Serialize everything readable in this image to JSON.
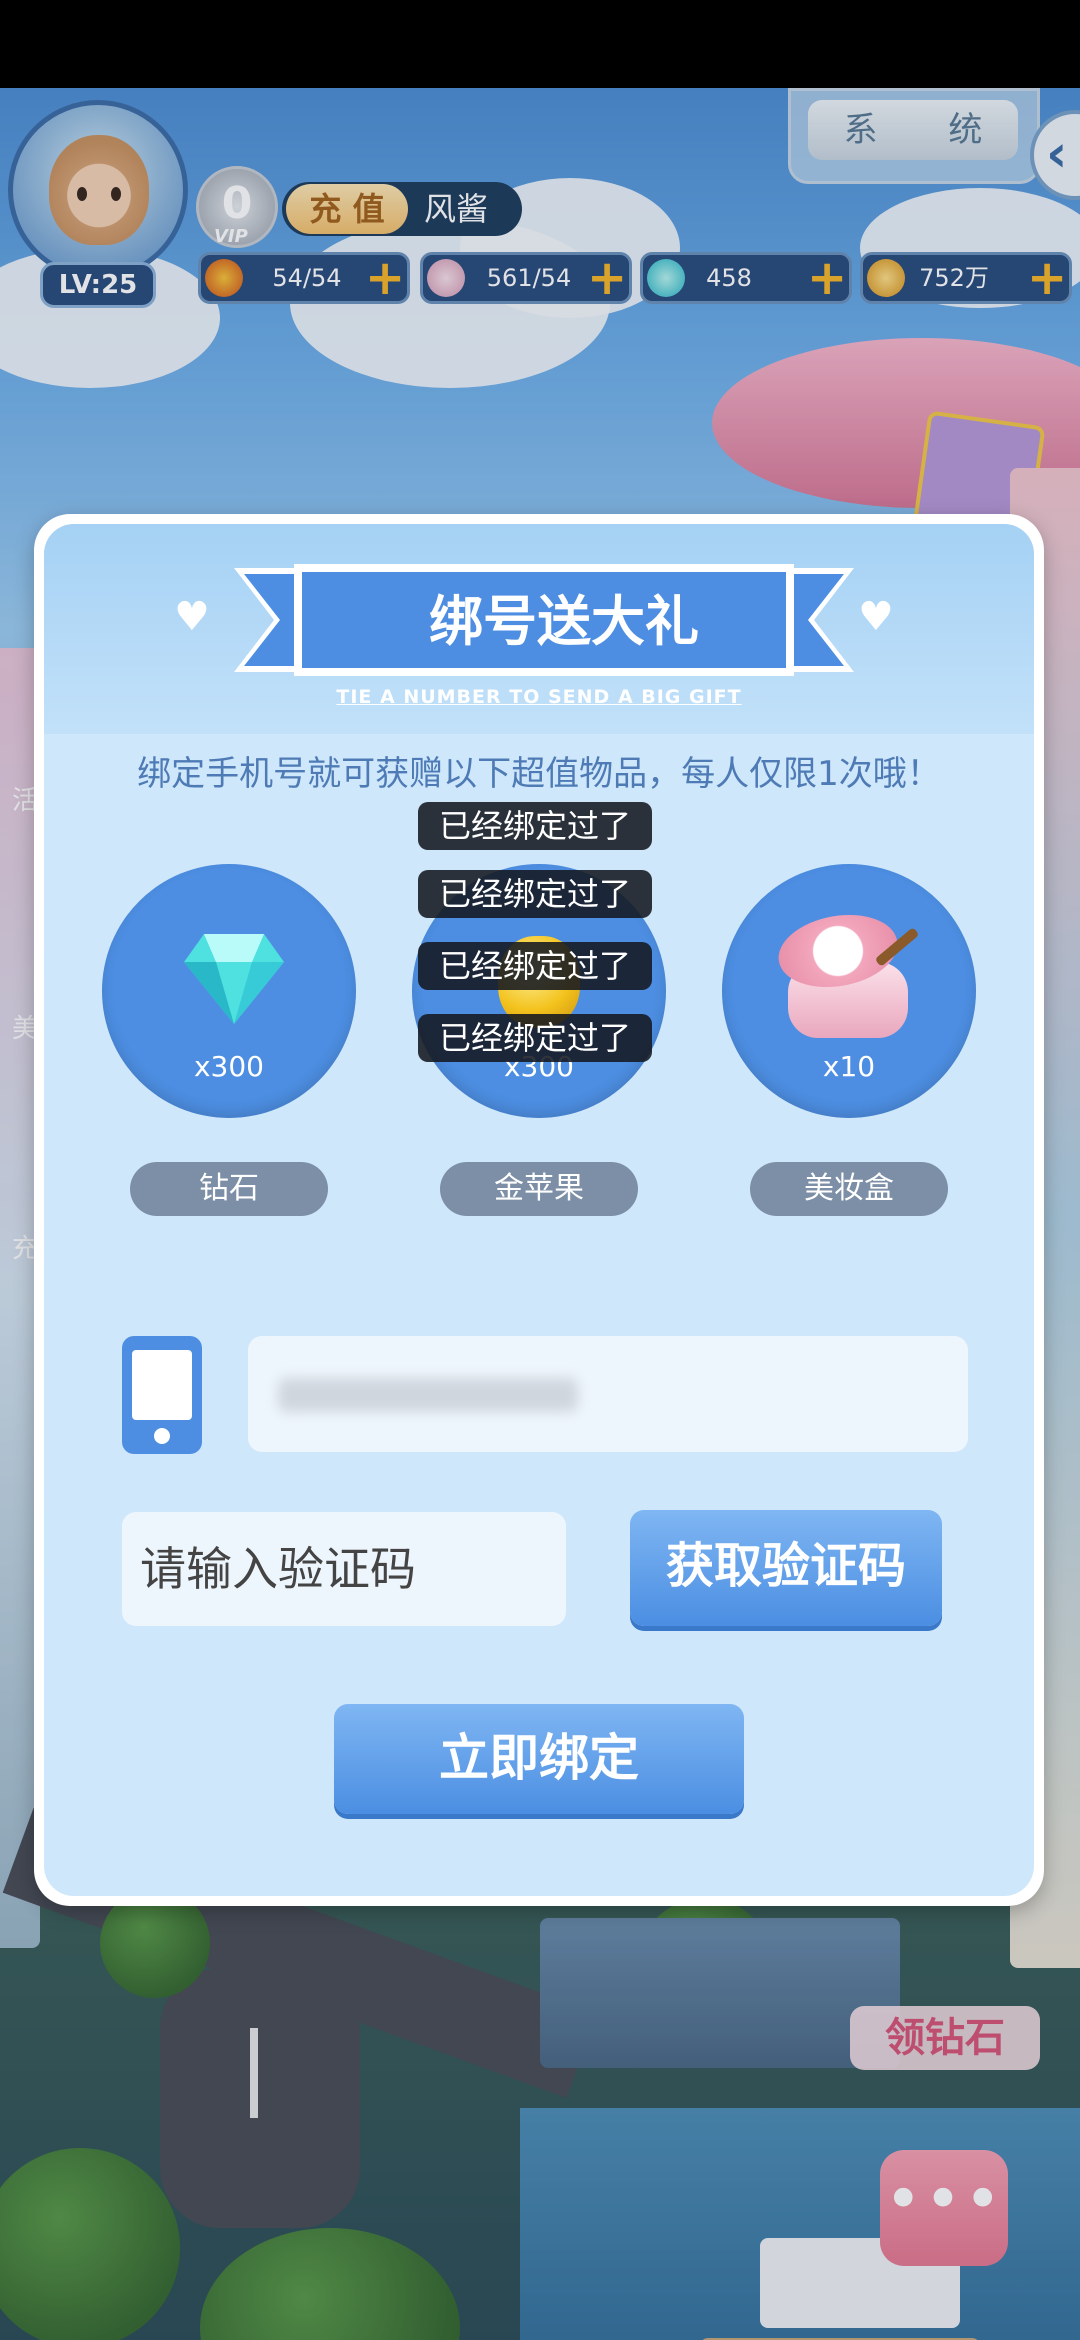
{
  "hud": {
    "level": "LV:25",
    "vip_level": "0",
    "vip_label": "VIP",
    "recharge_label": "充 值",
    "username": "风酱",
    "system_label": "系 统",
    "resources": [
      {
        "icon": "energy-icon",
        "value": "54/54"
      },
      {
        "icon": "wing-icon",
        "value": "561/54"
      },
      {
        "icon": "diamond-icon",
        "value": "458"
      },
      {
        "icon": "coin-icon",
        "value": "752万"
      }
    ]
  },
  "dialog": {
    "title": "绑号送大礼",
    "subtitle": "TIE A NUMBER TO SEND A BIG GIFT",
    "intro": "绑定手机号就可获赠以下超值物品，每人仅限1次哦！",
    "rewards": [
      {
        "icon": "diamond-icon",
        "qty": "x300",
        "name": "钻石"
      },
      {
        "icon": "golden-apple-icon",
        "qty": "x300",
        "name": "金苹果"
      },
      {
        "icon": "makeup-box-icon",
        "qty": "x10",
        "name": "美妆盒"
      }
    ],
    "toasts": [
      "已经绑定过了",
      "已经绑定过了",
      "已经绑定过了",
      "已经绑定过了"
    ],
    "code_placeholder": "请输入验证码",
    "get_code_label": "获取验证码",
    "bind_label": "立即绑定"
  },
  "side": {
    "get_diamonds_label": "领钻石",
    "more_label": "•••"
  },
  "colors": {
    "primary_blue": "#4d8ee2",
    "dialog_bg": "#cfe7fb",
    "intro_text": "#4e7bb5",
    "reward_pill": "#7c8fa6"
  }
}
